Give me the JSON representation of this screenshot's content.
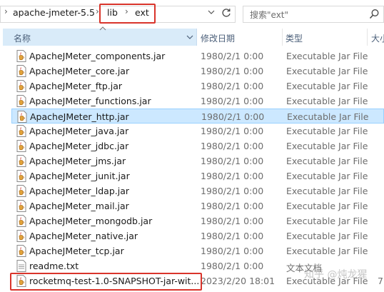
{
  "address": {
    "path": [
      "apache-jmeter-5.5",
      "lib",
      "ext"
    ]
  },
  "search": {
    "placeholder": "搜索\"ext\""
  },
  "columns": {
    "name": "名称",
    "date": "修改日期",
    "type": "类型",
    "size": "大小"
  },
  "files": [
    {
      "name": "ApacheJMeter_components.jar",
      "date": "1980/2/1 0:00",
      "type": "Executable Jar File",
      "size": "",
      "kind": "jar"
    },
    {
      "name": "ApacheJMeter_core.jar",
      "date": "1980/2/1 0:00",
      "type": "Executable Jar File",
      "size": "",
      "kind": "jar"
    },
    {
      "name": "ApacheJMeter_ftp.jar",
      "date": "1980/2/1 0:00",
      "type": "Executable Jar File",
      "size": "",
      "kind": "jar"
    },
    {
      "name": "ApacheJMeter_functions.jar",
      "date": "1980/2/1 0:00",
      "type": "Executable Jar File",
      "size": "",
      "kind": "jar"
    },
    {
      "name": "ApacheJMeter_http.jar",
      "date": "1980/2/1 0:00",
      "type": "Executable Jar File",
      "size": "",
      "kind": "jar",
      "selected": true
    },
    {
      "name": "ApacheJMeter_java.jar",
      "date": "1980/2/1 0:00",
      "type": "Executable Jar File",
      "size": "",
      "kind": "jar"
    },
    {
      "name": "ApacheJMeter_jdbc.jar",
      "date": "1980/2/1 0:00",
      "type": "Executable Jar File",
      "size": "",
      "kind": "jar"
    },
    {
      "name": "ApacheJMeter_jms.jar",
      "date": "1980/2/1 0:00",
      "type": "Executable Jar File",
      "size": "",
      "kind": "jar"
    },
    {
      "name": "ApacheJMeter_junit.jar",
      "date": "1980/2/1 0:00",
      "type": "Executable Jar File",
      "size": "",
      "kind": "jar"
    },
    {
      "name": "ApacheJMeter_ldap.jar",
      "date": "1980/2/1 0:00",
      "type": "Executable Jar File",
      "size": "",
      "kind": "jar"
    },
    {
      "name": "ApacheJMeter_mail.jar",
      "date": "1980/2/1 0:00",
      "type": "Executable Jar File",
      "size": "",
      "kind": "jar"
    },
    {
      "name": "ApacheJMeter_mongodb.jar",
      "date": "1980/2/1 0:00",
      "type": "Executable Jar File",
      "size": "",
      "kind": "jar"
    },
    {
      "name": "ApacheJMeter_native.jar",
      "date": "1980/2/1 0:00",
      "type": "Executable Jar File",
      "size": "",
      "kind": "jar"
    },
    {
      "name": "ApacheJMeter_tcp.jar",
      "date": "1980/2/1 0:00",
      "type": "Executable Jar File",
      "size": "",
      "kind": "jar"
    },
    {
      "name": "readme.txt",
      "date": "1980/2/1 0:00",
      "type": "文本文档",
      "size": "",
      "kind": "txt"
    },
    {
      "name": "rocketmq-test-1.0-SNAPSHOT-jar-wit...",
      "date": "2023/2/20 18:01",
      "type": "Executable Jar File",
      "size": "7,",
      "kind": "jar"
    }
  ],
  "watermark": "知乎 @炖龙猩",
  "colors": {
    "highlight_border": "#d9342b",
    "selection": "#cce8ff",
    "header_bg": "#d9ebf9"
  }
}
